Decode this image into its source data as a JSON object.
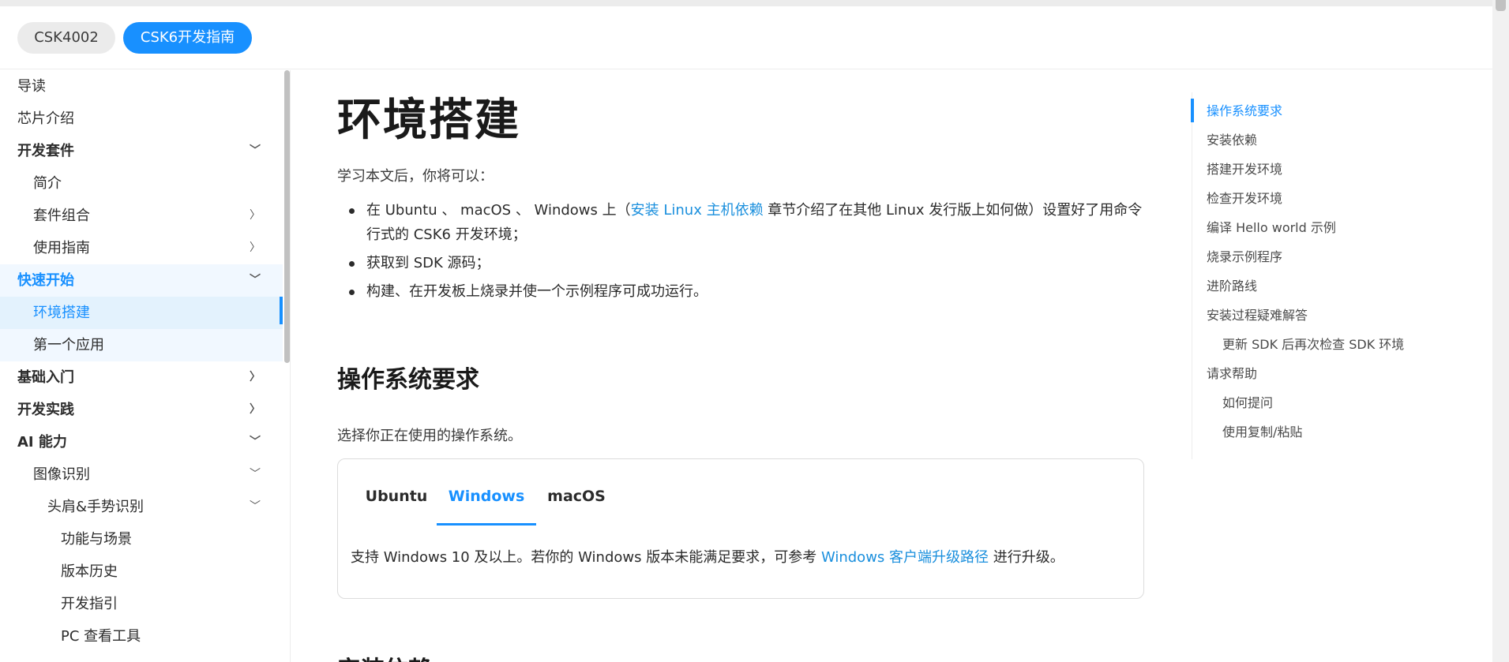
{
  "header": {
    "tabs": [
      {
        "label": "CSK4002",
        "active": false
      },
      {
        "label": "CSK6开发指南",
        "active": true
      }
    ]
  },
  "sidebar": {
    "items": [
      {
        "label": "导读"
      },
      {
        "label": "芯片介绍"
      },
      {
        "label": "开发套件",
        "caret": "chevron-down-icon"
      },
      {
        "label": "简介"
      },
      {
        "label": "套件组合",
        "caret": "chevron-right-icon"
      },
      {
        "label": "使用指南",
        "caret": "chevron-right-icon"
      },
      {
        "label": "快速开始",
        "caret": "chevron-down-icon"
      },
      {
        "label": "环境搭建"
      },
      {
        "label": "第一个应用"
      },
      {
        "label": "基础入门",
        "caret": "chevron-right-icon"
      },
      {
        "label": "开发实践",
        "caret": "chevron-right-icon"
      },
      {
        "label": "AI 能力",
        "caret": "chevron-down-icon"
      },
      {
        "label": "图像识别",
        "caret": "chevron-down-icon"
      },
      {
        "label": "头肩&手势识别",
        "caret": "chevron-down-icon"
      },
      {
        "label": "功能与场景"
      },
      {
        "label": "版本历史"
      },
      {
        "label": "开发指引"
      },
      {
        "label": "PC 查看工具"
      }
    ]
  },
  "main": {
    "title": "环境搭建",
    "intro": "学习本文后，你将可以：",
    "goals": {
      "g1_a": "在 Ubuntu 、 macOS 、 Windows 上（",
      "g1_link": "安装 Linux 主机依赖",
      "g1_b": " 章节介绍了在其他 Linux 发行版上如何做）设置好了用命令行式的 CSK6 开发环境；",
      "g2": "获取到 SDK 源码；",
      "g3": "构建、在开发板上烧录并使一个示例程序可成功运行。"
    },
    "section_title": "操作系统要求",
    "choose_text": "选择你正在使用的操作系统。",
    "os_tabs": {
      "ubuntu": "Ubuntu",
      "windows": "Windows",
      "macos": "macOS"
    },
    "windows_text_a": "支持 Windows 10 及以上。若你的 Windows 版本未能满足要求，可参考 ",
    "windows_link": "Windows 客户端升级路径",
    "windows_text_b": " 进行升级。",
    "next_heading": "安装依赖"
  },
  "toc": {
    "items": [
      {
        "label": "操作系统要求"
      },
      {
        "label": "安装依赖"
      },
      {
        "label": "搭建开发环境"
      },
      {
        "label": "检查开发环境"
      },
      {
        "label": "编译 Hello world 示例"
      },
      {
        "label": "烧录示例程序"
      },
      {
        "label": "进阶路线"
      },
      {
        "label": "安装过程疑难解答"
      },
      {
        "label": "更新 SDK 后再次检查 SDK 环境"
      },
      {
        "label": "请求帮助"
      },
      {
        "label": "如何提问"
      },
      {
        "label": "使用复制/粘贴"
      }
    ]
  },
  "colors": {
    "accent": "#1890ff",
    "link": "#1a8fdd"
  }
}
